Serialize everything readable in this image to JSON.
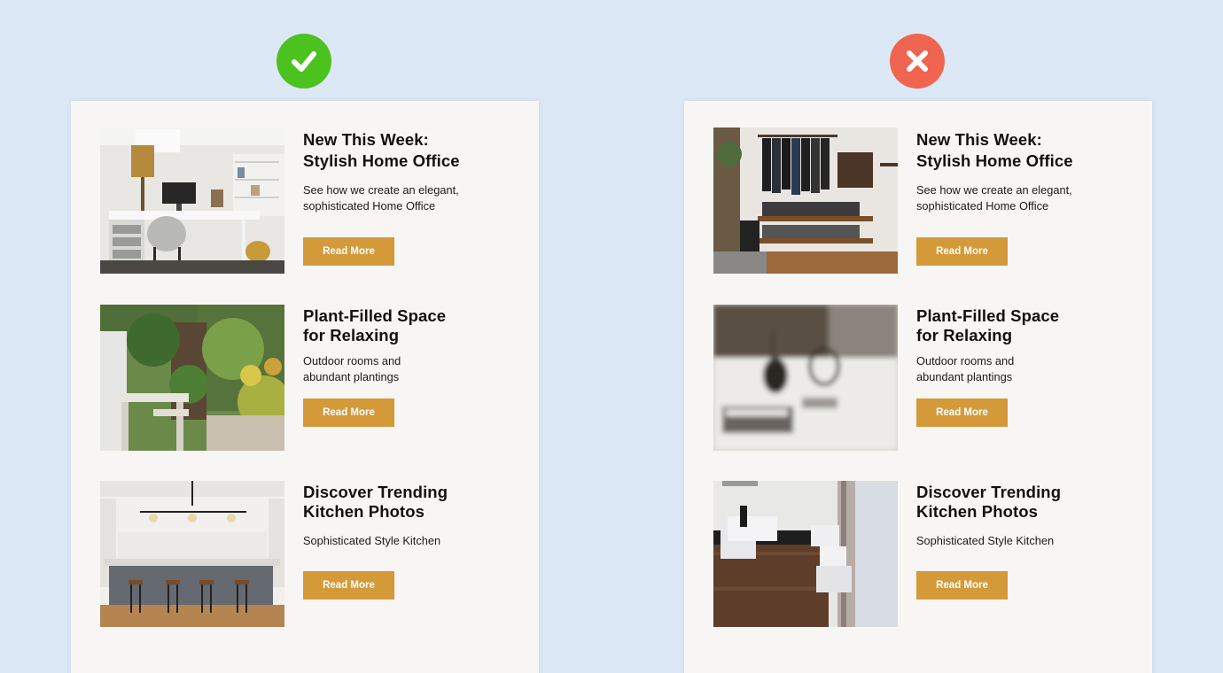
{
  "badges": {
    "good_icon": "checkmark-icon",
    "bad_icon": "x-mark-icon",
    "good_color": "#4cc21f",
    "bad_color": "#f06550"
  },
  "accent_color": "#d49a3a",
  "left_panel": {
    "items": [
      {
        "title_line1": "New This Week:",
        "title_line2": "Stylish Home Office",
        "description": "See how we create an elegant, sophisticated Home Office",
        "button": "Read More",
        "image": "home-office-photo"
      },
      {
        "title_line1": "Plant-Filled Space",
        "title_line2": "for Relaxing",
        "description": "Outdoor rooms and abundant plantings",
        "button": "Read More",
        "image": "garden-patio-photo"
      },
      {
        "title_line1": "Discover Trending",
        "title_line2": "Kitchen Photos",
        "description": "Sophisticated Style Kitchen",
        "button": "Read More",
        "image": "kitchen-island-photo"
      }
    ]
  },
  "right_panel": {
    "items": [
      {
        "title_line1": "New This Week:",
        "title_line2": "Stylish Home Office",
        "description": "See how we create an elegant, sophisticated Home Office",
        "button": "Read More",
        "image": "closet-shelving-photo"
      },
      {
        "title_line1": "Plant-Filled Space",
        "title_line2": "for Relaxing",
        "description": "Outdoor rooms and abundant plantings",
        "button": "Read More",
        "image": "blurry-vase-photo"
      },
      {
        "title_line1": "Discover Trending",
        "title_line2": "Kitchen Photos",
        "description": "Sophisticated Style Kitchen",
        "button": "Read More",
        "image": "pixelated-bathroom-photo"
      }
    ]
  }
}
